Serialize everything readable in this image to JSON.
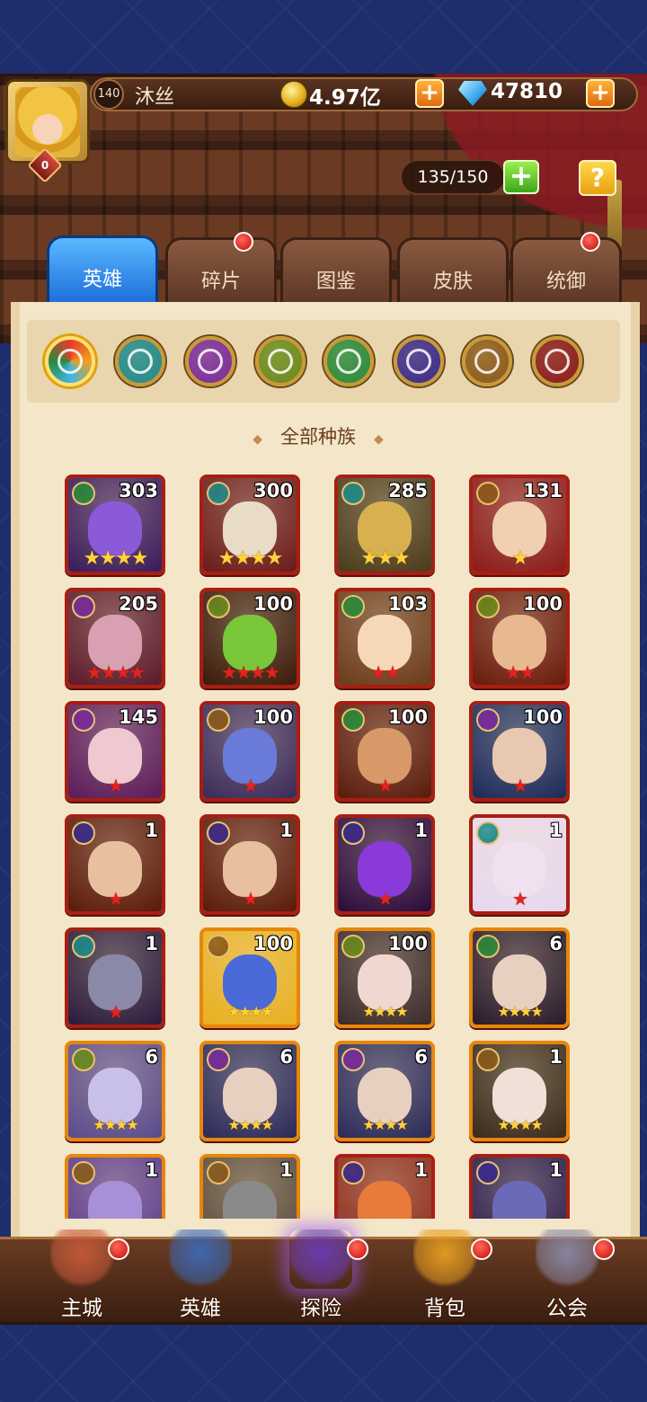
{
  "player": {
    "level": "140",
    "name": "沐丝",
    "vip": "0",
    "gold": "4.97亿",
    "diamonds": "47810"
  },
  "hero_capacity": "135/150",
  "help_label": "?",
  "tabs": [
    {
      "label": "英雄",
      "active": true,
      "has_dot": false
    },
    {
      "label": "碎片",
      "active": false,
      "has_dot": true
    },
    {
      "label": "图鉴",
      "active": false,
      "has_dot": false
    },
    {
      "label": "皮肤",
      "active": false,
      "has_dot": false
    },
    {
      "label": "统御",
      "active": false,
      "has_dot": true
    }
  ],
  "factions": [
    {
      "name": "all-races",
      "color": "#f08a2a",
      "selected": true
    },
    {
      "name": "water",
      "color": "#1e8a8a"
    },
    {
      "name": "shadow",
      "color": "#7a2a9a"
    },
    {
      "name": "eye",
      "color": "#6a8a1a"
    },
    {
      "name": "nature",
      "color": "#2a8a3a"
    },
    {
      "name": "demon",
      "color": "#3a2a8a"
    },
    {
      "name": "light",
      "color": "#8a5a1a"
    },
    {
      "name": "fire",
      "color": "#8a1a1a"
    }
  ],
  "filter_title": "全部种族",
  "heroes": [
    {
      "level": "303",
      "stars": "★★★★",
      "star_type": "gold",
      "race": "nature",
      "race_color": "#2a8a3a",
      "bg": "#3a1a5a",
      "skin": "#8a5ad8",
      "frame": "red"
    },
    {
      "level": "300",
      "stars": "★★★★",
      "star_type": "gold",
      "race": "water",
      "race_color": "#1e8a8a",
      "bg": "#6a1a1a",
      "skin": "#e8dcc8",
      "frame": "red"
    },
    {
      "level": "285",
      "stars": "★★★",
      "star_type": "gold",
      "race": "water",
      "race_color": "#1e8a8a",
      "bg": "#4a3a1a",
      "skin": "#d8b050",
      "frame": "red"
    },
    {
      "level": "131",
      "stars": "★",
      "star_type": "gold",
      "race": "light",
      "race_color": "#8a5a1a",
      "bg": "#8a1a1a",
      "skin": "#f0d0b0",
      "frame": "red"
    },
    {
      "level": "205",
      "stars": "★★★★",
      "star_type": "red",
      "race": "shadow",
      "race_color": "#7a2a9a",
      "bg": "#5a1a2a",
      "skin": "#d8a0b0",
      "frame": "red"
    },
    {
      "level": "100",
      "stars": "★★★★",
      "star_type": "red",
      "race": "eye",
      "race_color": "#6a8a1a",
      "bg": "#3a1a0a",
      "skin": "#7ac83a",
      "frame": "red"
    },
    {
      "level": "103",
      "stars": "★★",
      "star_type": "red",
      "race": "nature",
      "race_color": "#2a8a3a",
      "bg": "#6a3a1a",
      "skin": "#f6d8b8",
      "frame": "red"
    },
    {
      "level": "100",
      "stars": "★★",
      "star_type": "red",
      "race": "eye",
      "race_color": "#6a8a1a",
      "bg": "#6a1a0a",
      "skin": "#e8b890",
      "frame": "red"
    },
    {
      "level": "145",
      "stars": "★",
      "star_type": "red",
      "race": "shadow",
      "race_color": "#7a2a9a",
      "bg": "#5a1a5a",
      "skin": "#f0c8d0",
      "frame": "red"
    },
    {
      "level": "100",
      "stars": "★",
      "star_type": "red",
      "race": "light",
      "race_color": "#8a5a1a",
      "bg": "#3a2a5a",
      "skin": "#6a7ad8",
      "frame": "red"
    },
    {
      "level": "100",
      "stars": "★",
      "star_type": "red",
      "race": "nature",
      "race_color": "#2a8a3a",
      "bg": "#5a1a0a",
      "skin": "#d89868",
      "frame": "red"
    },
    {
      "level": "100",
      "stars": "★",
      "star_type": "red",
      "race": "shadow",
      "race_color": "#7a2a9a",
      "bg": "#1a2a5a",
      "skin": "#e8c8b0",
      "frame": "red"
    },
    {
      "level": "1",
      "stars": "★",
      "star_type": "red",
      "race": "demon",
      "race_color": "#3a2a8a",
      "bg": "#5a1a0a",
      "skin": "#e8c0a0",
      "frame": "red"
    },
    {
      "level": "1",
      "stars": "★",
      "star_type": "red",
      "race": "demon",
      "race_color": "#3a2a8a",
      "bg": "#5a1a0a",
      "skin": "#e8c0a0",
      "frame": "red"
    },
    {
      "level": "1",
      "stars": "★",
      "star_type": "red",
      "race": "demon",
      "race_color": "#3a2a8a",
      "bg": "#2a0a3a",
      "skin": "#8a3ad8",
      "frame": "red"
    },
    {
      "level": "1",
      "stars": "★",
      "star_type": "red",
      "race": "water",
      "race_color": "#1e8a8a",
      "bg": "#e8d8f0",
      "skin": "#f0e0f0",
      "frame": "red"
    },
    {
      "level": "1",
      "stars": "★",
      "star_type": "red",
      "race": "water",
      "race_color": "#1e8a8a",
      "bg": "#2a1a3a",
      "skin": "#8a8aa8",
      "frame": "red"
    },
    {
      "level": "100",
      "stars": "★★★★",
      "star_type": "small",
      "race": "light",
      "race_color": "#8a5a1a",
      "bg": "#e8b020",
      "skin": "#4a6ad8",
      "frame": "gold"
    },
    {
      "level": "100",
      "stars": "★★★★",
      "star_type": "small",
      "race": "eye",
      "race_color": "#6a8a1a",
      "bg": "#3a2a2a",
      "skin": "#f0d8d0",
      "frame": "gold"
    },
    {
      "level": "6",
      "stars": "★★★★",
      "star_type": "small",
      "race": "nature",
      "race_color": "#2a8a3a",
      "bg": "#2a1a2a",
      "skin": "#e8d0c0",
      "frame": "gold"
    },
    {
      "level": "6",
      "stars": "★★★★",
      "star_type": "small",
      "race": "eye",
      "race_color": "#6a8a1a",
      "bg": "#5a4a8a",
      "skin": "#c8c0e8",
      "frame": "gold"
    },
    {
      "level": "6",
      "stars": "★★★★",
      "star_type": "small",
      "race": "shadow",
      "race_color": "#7a2a9a",
      "bg": "#2a2a5a",
      "skin": "#e8d0c0",
      "frame": "gold"
    },
    {
      "level": "6",
      "stars": "★★★★",
      "star_type": "small",
      "race": "shadow",
      "race_color": "#7a2a9a",
      "bg": "#2a2a5a",
      "skin": "#e8d0c0",
      "frame": "gold"
    },
    {
      "level": "1",
      "stars": "★★★★",
      "star_type": "small",
      "race": "light",
      "race_color": "#8a5a1a",
      "bg": "#3a2a1a",
      "skin": "#f0e0d8",
      "frame": "gold"
    },
    {
      "level": "1",
      "stars": "",
      "star_type": "small",
      "race": "light",
      "race_color": "#8a5a1a",
      "bg": "#5a3a8a",
      "skin": "#a890d8",
      "frame": "gold"
    },
    {
      "level": "1",
      "stars": "",
      "star_type": "small",
      "race": "light",
      "race_color": "#8a5a1a",
      "bg": "#5a4a3a",
      "skin": "#8a8a8a",
      "frame": "gold"
    },
    {
      "level": "1",
      "stars": "",
      "star_type": "small",
      "race": "demon",
      "race_color": "#3a2a8a",
      "bg": "#8a2a1a",
      "skin": "#e87a3a",
      "frame": "red"
    },
    {
      "level": "1",
      "stars": "",
      "star_type": "small",
      "race": "demon",
      "race_color": "#3a2a8a",
      "bg": "#2a1a4a",
      "skin": "#6a6ab8",
      "frame": "red"
    }
  ],
  "bottom_nav": [
    {
      "label": "主城",
      "icon": "castle-icon",
      "color": "#c85a3a",
      "has_dot": true
    },
    {
      "label": "英雄",
      "icon": "hero-icon",
      "color": "#3a6ab8",
      "has_dot": false
    },
    {
      "label": "探险",
      "icon": "portal-icon",
      "color": "#6a3ab8",
      "has_dot": true,
      "active": true
    },
    {
      "label": "背包",
      "icon": "backpack-icon",
      "color": "#e8a020",
      "has_dot": true
    },
    {
      "label": "公会",
      "icon": "guild-tower-icon",
      "color": "#8a8aa8",
      "has_dot": true
    }
  ]
}
